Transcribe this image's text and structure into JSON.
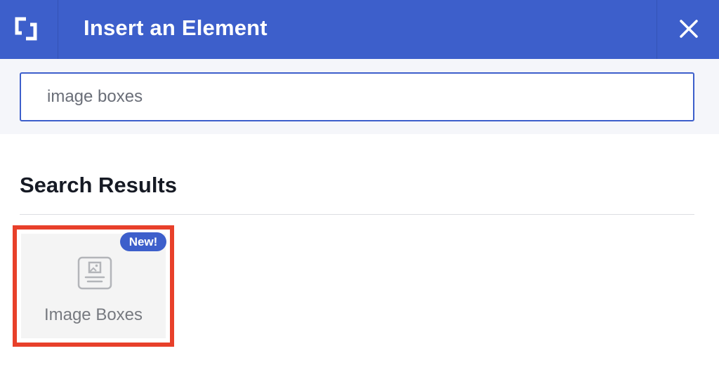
{
  "header": {
    "title": "Insert an Element",
    "logo_icon": "brackets-logo-icon",
    "close_icon": "close-icon",
    "background": "#3d5fcb"
  },
  "search": {
    "value": "image boxes"
  },
  "results": {
    "heading": "Search Results",
    "items": [
      {
        "label": "Image Boxes",
        "badge": "New!",
        "icon": "image-box-icon",
        "highlighted": true
      }
    ]
  },
  "colors": {
    "accent": "#3d5fcb",
    "highlight": "#e8402a"
  }
}
